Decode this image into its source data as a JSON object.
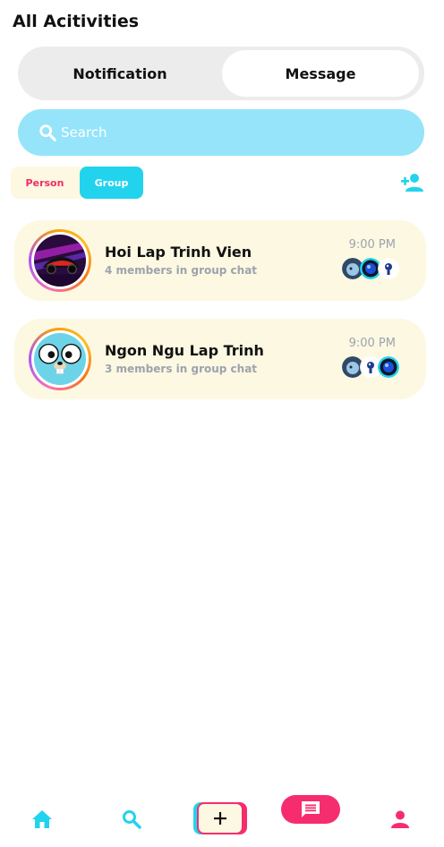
{
  "header": {
    "title": "All Acitivities"
  },
  "tabs": {
    "notification": "Notification",
    "message": "Message",
    "active": "message"
  },
  "search": {
    "placeholder": "Search"
  },
  "filter": {
    "person": "Person",
    "group": "Group",
    "active": "group"
  },
  "groups": [
    {
      "name": "Hoi Lap Trinh Vien",
      "subtitle": "4 members in group chat",
      "time": "9:00 PM"
    },
    {
      "name": "Ngon Ngu Lap Trinh",
      "subtitle": "3 members in group chat",
      "time": "9:00 PM"
    }
  ],
  "icons": {
    "add_user": "person-add-icon",
    "search": "search-icon",
    "home": "home-icon",
    "nav_search": "search-icon",
    "create": "plus-icon",
    "chat": "chat-icon",
    "profile": "person-icon"
  },
  "colors": {
    "accent_cyan": "#22d3ee",
    "accent_pink": "#f52d6e",
    "search_bg": "#95e4fa",
    "card_bg": "#fdf8e1"
  }
}
